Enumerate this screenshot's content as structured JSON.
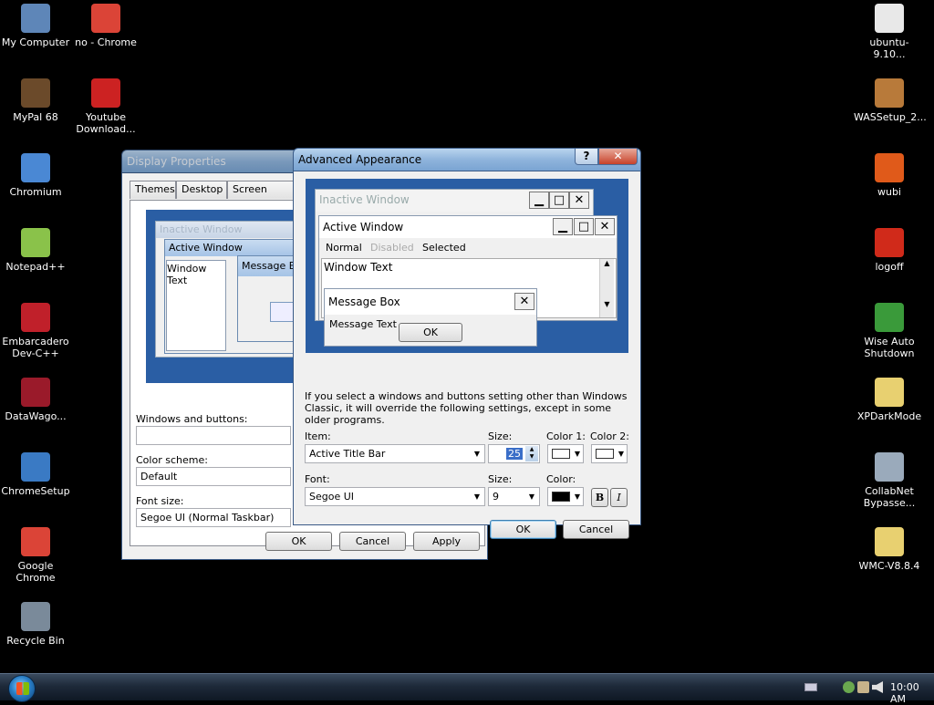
{
  "desktop_left": [
    {
      "label": "My Computer",
      "icon": "computer-icon",
      "color": "#5e86b8"
    },
    {
      "label": "no - Chrome",
      "icon": "chrome-icon",
      "color": "#db4437"
    },
    {
      "label": "MyPal 68",
      "icon": "mypal-icon",
      "color": "#6b4a2a"
    },
    {
      "label": "Youtube Download...",
      "icon": "youtube-download-icon",
      "color": "#cc2222"
    },
    {
      "label": "Chromium",
      "icon": "chromium-icon",
      "color": "#4a88d4"
    },
    {
      "label": "Notepad++",
      "icon": "notepadpp-icon",
      "color": "#8ac24a"
    },
    {
      "label": "Embarcadero Dev-C++",
      "icon": "devcpp-icon",
      "color": "#c0202a"
    },
    {
      "label": "DataWago...",
      "icon": "datawago-icon",
      "color": "#9a1a2a"
    },
    {
      "label": "ChromeSetup",
      "icon": "setup-icon",
      "color": "#3a7ac4"
    },
    {
      "label": "Google Chrome",
      "icon": "chrome-icon",
      "color": "#db4437"
    },
    {
      "label": "Recycle Bin",
      "icon": "recycle-bin-icon",
      "color": "#7a8a9a"
    }
  ],
  "desktop_right": [
    {
      "label": "ubuntu-9.10...",
      "icon": "file-icon",
      "color": "#e8e8e8"
    },
    {
      "label": "WASSetup_2...",
      "icon": "package-icon",
      "color": "#b87a3a"
    },
    {
      "label": "wubi",
      "icon": "wubi-icon",
      "color": "#e05a1a"
    },
    {
      "label": "logoff",
      "icon": "power-icon",
      "color": "#d02a1a"
    },
    {
      "label": "Wise Auto Shutdown",
      "icon": "wise-shutdown-icon",
      "color": "#3a9a3a"
    },
    {
      "label": "XPDarkMode",
      "icon": "zip-folder-icon",
      "color": "#e8d070"
    },
    {
      "label": "CollabNet Bypasse...",
      "icon": "installer-icon",
      "color": "#9aaabb"
    },
    {
      "label": "WMC-V8.8.4",
      "icon": "zip-folder-icon",
      "color": "#e8d070"
    }
  ],
  "display_props": {
    "title": "Display Properties",
    "tabs": [
      "Themes",
      "Desktop",
      "Screen Saver"
    ],
    "preview": {
      "inactive": "Inactive Window",
      "active": "Active Window",
      "window_text": "Window Text",
      "message_box": "Message Bo"
    },
    "windows_buttons_label": "Windows and buttons:",
    "windows_buttons_value": "",
    "color_scheme_label": "Color scheme:",
    "color_scheme_value": "Default",
    "font_size_label": "Font size:",
    "font_size_value": "Segoe UI (Normal Taskbar)",
    "ok": "OK",
    "cancel": "Cancel",
    "apply": "Apply"
  },
  "advanced": {
    "title": "Advanced Appearance",
    "help_glyph": "?",
    "close_glyph": "✕",
    "preview": {
      "inactive": "Inactive Window",
      "active": "Active Window",
      "normal": "Normal",
      "disabled": "Disabled",
      "selected": "Selected",
      "window_text": "Window Text",
      "message_box": "Message Box",
      "message_text": "Message Text",
      "ok": "OK"
    },
    "info": "If you select a windows and buttons setting other than Windows Classic, it will override the following settings, except in some older programs.",
    "item_label": "Item:",
    "item_value": "Active Title Bar",
    "size_label": "Size:",
    "size_value": "25",
    "color1_label": "Color 1:",
    "color2_label": "Color 2:",
    "font_label": "Font:",
    "font_value": "Segoe UI",
    "font_size_label": "Size:",
    "font_size_value": "9",
    "color_label": "Color:",
    "bold": "B",
    "italic": "I",
    "ok": "OK",
    "cancel": "Cancel"
  },
  "taskbar": {
    "clock": "10:00 AM"
  }
}
